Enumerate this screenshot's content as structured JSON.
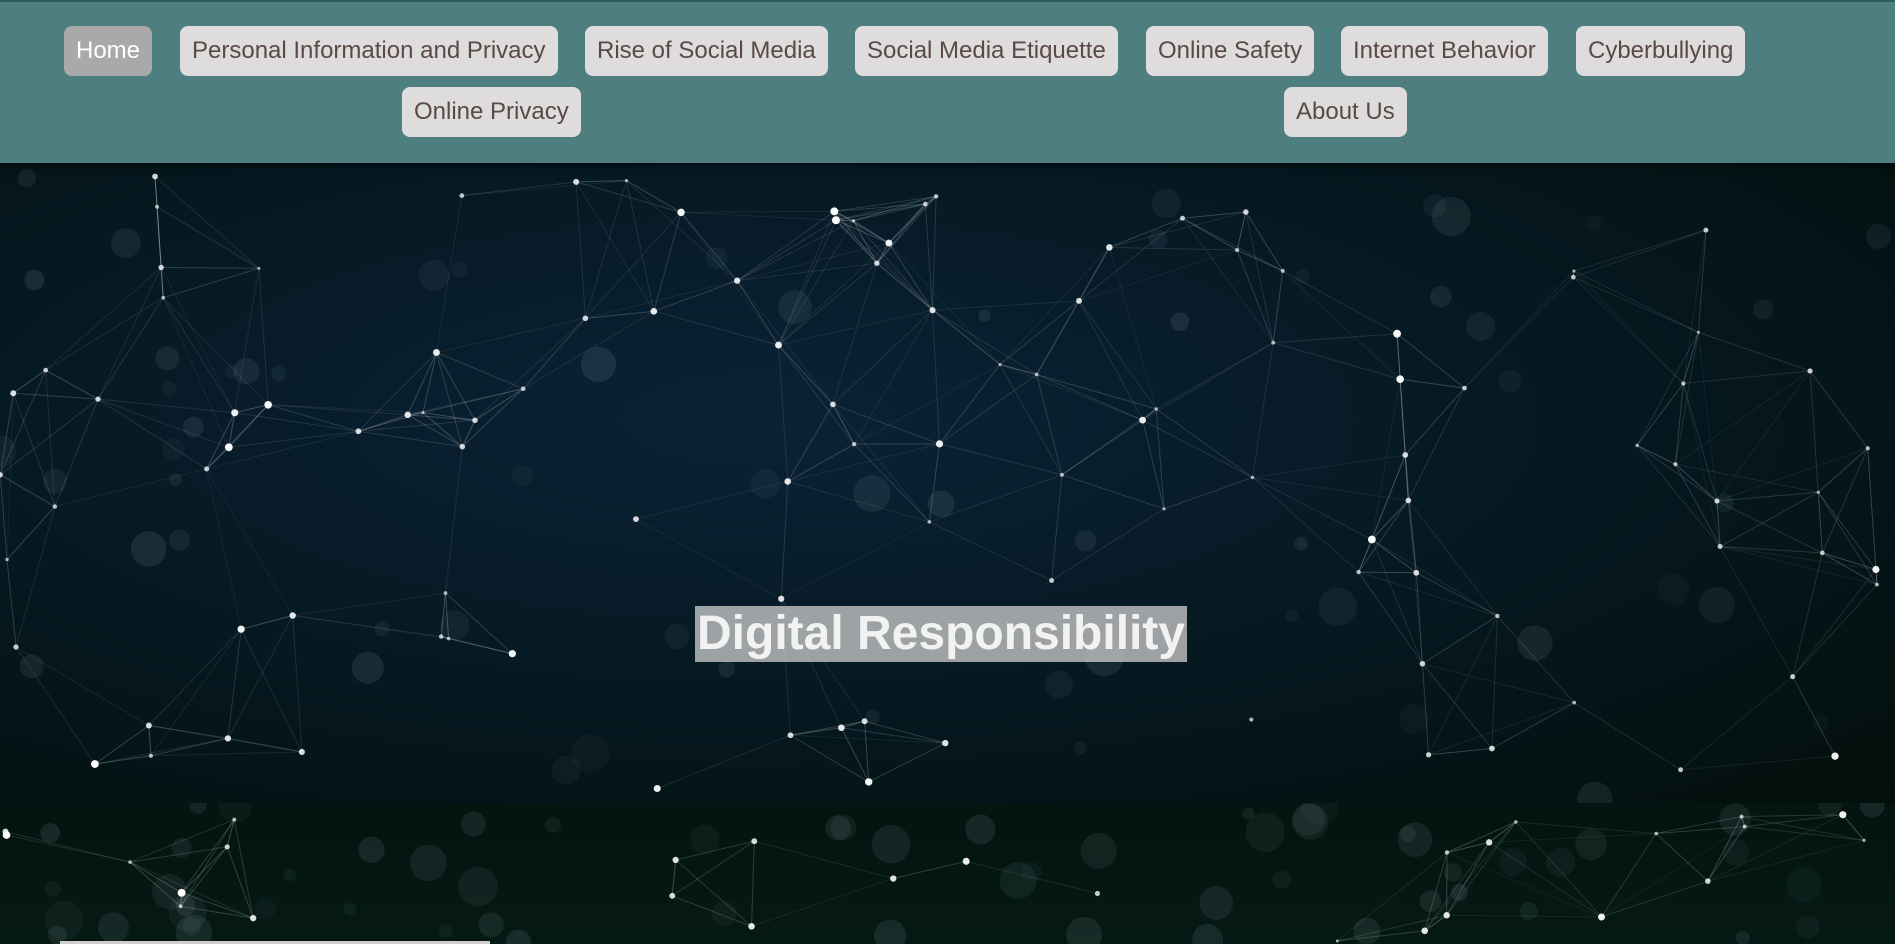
{
  "nav": {
    "items": [
      {
        "label": "Home",
        "active": true
      },
      {
        "label": "Personal Information and Privacy",
        "active": false
      },
      {
        "label": "Rise of Social Media",
        "active": false
      },
      {
        "label": "Social Media Etiquette",
        "active": false
      },
      {
        "label": "Online Safety",
        "active": false
      },
      {
        "label": "Internet Behavior",
        "active": false
      },
      {
        "label": "Cyberbullying",
        "active": false
      },
      {
        "label": "Online Privacy",
        "active": false
      },
      {
        "label": "About Us",
        "active": false
      }
    ]
  },
  "hero": {
    "title": "Digital Responsibility",
    "background_image": "network-plexus-background"
  },
  "colors": {
    "nav_background": "#4f7e80",
    "nav_button": "#dedcdc",
    "nav_button_active": "#a9a9a9",
    "nav_text": "#5a4a46"
  }
}
